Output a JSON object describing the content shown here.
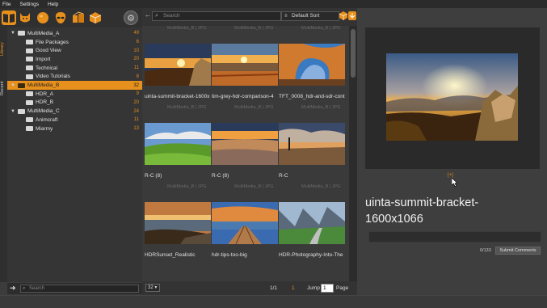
{
  "menu": [
    "File",
    "Settings",
    "Help"
  ],
  "sidetabs": [
    "Library",
    "Recent"
  ],
  "tree": [
    {
      "label": "MultiMedia_A",
      "count": "49",
      "level": 0,
      "expanded": true,
      "selected": false
    },
    {
      "label": "File Packages",
      "count": "6",
      "level": 1,
      "expanded": false,
      "selected": false
    },
    {
      "label": "Good View",
      "count": "10",
      "level": 1,
      "expanded": false,
      "selected": false
    },
    {
      "label": "Import",
      "count": "20",
      "level": 1,
      "expanded": false,
      "selected": false
    },
    {
      "label": "Technical",
      "count": "11",
      "level": 1,
      "expanded": false,
      "selected": false
    },
    {
      "label": "Video Tutorials",
      "count": "8",
      "level": 1,
      "expanded": false,
      "selected": false
    },
    {
      "label": "MultiMedia_B",
      "count": "32",
      "level": 0,
      "expanded": true,
      "selected": true
    },
    {
      "label": "HDR_A",
      "count": "9",
      "level": 1,
      "expanded": false,
      "selected": false
    },
    {
      "label": "HDR_B",
      "count": "20",
      "level": 1,
      "expanded": false,
      "selected": false
    },
    {
      "label": "MultiMedia_C",
      "count": "24",
      "level": 0,
      "expanded": true,
      "selected": false
    },
    {
      "label": "Animcraft",
      "count": "11",
      "level": 1,
      "expanded": false,
      "selected": false
    },
    {
      "label": "Miarmy",
      "count": "13",
      "level": 1,
      "expanded": false,
      "selected": false
    }
  ],
  "left_search": {
    "placeholder": "Search"
  },
  "grid_search": {
    "placeholder": "Search"
  },
  "sort": {
    "label": "Default Sort"
  },
  "watermark": "MultiMedia_B | JPG",
  "thumbnails": [
    {
      "caption": "uinta-summit-bracket-1600x",
      "scene": "sunset-rocks"
    },
    {
      "caption": "tim-grey-hdr-comparison-4",
      "scene": "canyon-sunset"
    },
    {
      "caption": "TFT_0008_hdr-and-sdr-cont",
      "scene": "arch-blue"
    },
    {
      "caption": "R-C (8)",
      "scene": "green-hills"
    },
    {
      "caption": "R-C (8)",
      "scene": "orange-field"
    },
    {
      "caption": "R-C",
      "scene": "cloudy-field"
    },
    {
      "caption": "HDRSunset_Realistic",
      "scene": "sea-sunset"
    },
    {
      "caption": "hdr-tips-too-big",
      "scene": "dock-sky"
    },
    {
      "caption": "HDR-Photography-Into-The",
      "scene": "valley-road"
    }
  ],
  "footer": {
    "per_page": "32",
    "pages": "1/1",
    "current": "1",
    "jump_label": "Jump",
    "jump_value": "1",
    "page_label": "Page"
  },
  "preview": {
    "fullscreen_link": "[+]",
    "title": "uinta-summit-bracket-1600x1066",
    "comment_count": "0/133",
    "submit_label": "Submit Comments"
  },
  "colors": {
    "accent": "#e8901c",
    "background": "#3c3c3c"
  }
}
